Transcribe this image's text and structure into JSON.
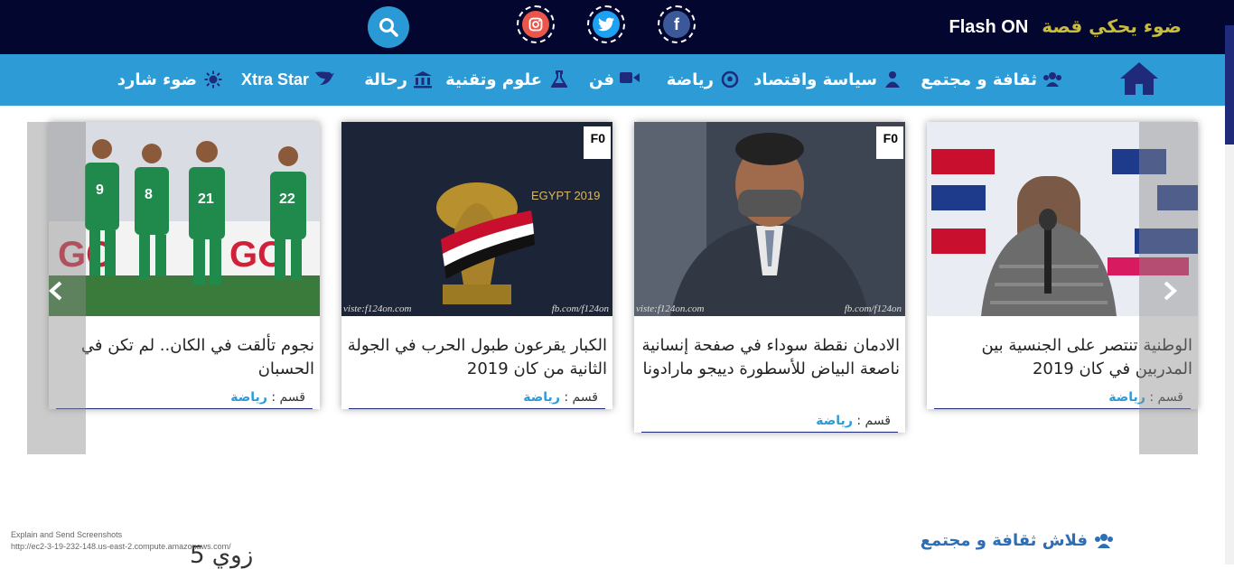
{
  "topbar": {
    "brand_ar": "ضوء يحكي قصة",
    "brand_en": "Flash ON",
    "social": [
      {
        "name": "facebook-icon",
        "color": "#3b5998"
      },
      {
        "name": "twitter-icon",
        "color": "#1da1f2"
      },
      {
        "name": "instagram-icon",
        "color": "#e1306c"
      }
    ],
    "search_icon": "search-icon"
  },
  "nav": {
    "home_icon": "home-icon",
    "items": [
      {
        "label": "ثقافة و مجتمع",
        "icon": "users-icon"
      },
      {
        "label": "سياسة واقتصاد",
        "icon": "user-tie-icon"
      },
      {
        "label": "رياضة",
        "icon": "football-icon"
      },
      {
        "label": "فن",
        "icon": "video-camera-icon"
      },
      {
        "label": "علوم وتقنية",
        "icon": "flask-icon"
      },
      {
        "label": "رحالة",
        "icon": "bank-icon"
      },
      {
        "label": "Xtra Star",
        "icon": "bird-icon"
      },
      {
        "label": "ضوء شارد",
        "icon": "sun-icon"
      }
    ]
  },
  "cards": [
    {
      "title": "الوطنية تنتصر على الجنسية بين المدربين في كان 2019",
      "category_label": "قسم :",
      "category": "رياضة"
    },
    {
      "title": "الادمان نقطة سوداء في صفحة إنسانية ناصعة البياض للأسطورة دييجو مارادونا",
      "category_label": "قسم :",
      "category": "رياضة",
      "watermark_left": "viste:f124on.com",
      "watermark_right": "fb.com/f124on"
    },
    {
      "title": "الكبار يقرعون طبول الحرب في الجولة الثانية من كان 2019",
      "category_label": "قسم :",
      "category": "رياضة",
      "image_text": "EGYPT 2019",
      "watermark_left": "viste:f124on.com",
      "watermark_right": "fb.com/f124on"
    },
    {
      "title": "نجوم تألقت في الكان.. لم تكن في الحسبان",
      "category_label": "قسم :",
      "category": "رياضة"
    }
  ],
  "carousel": {
    "prev_icon": "chevron-left-icon",
    "next_icon": "chevron-right-icon"
  },
  "section": {
    "title": "فلاش ثقافة و مجتمع",
    "icon": "users-icon"
  },
  "overlay": {
    "line1": "Explain and Send Screenshots",
    "line2": "http://ec2-3-19-232-148.us-east-2.compute.amazonaws.com/"
  },
  "partial": {
    "text": "زوي 5"
  },
  "colors": {
    "topbar": "#03062e",
    "nav": "#2d9bd6",
    "brand_gold": "#c9bd3c",
    "link_blue": "#2d9bd6"
  }
}
